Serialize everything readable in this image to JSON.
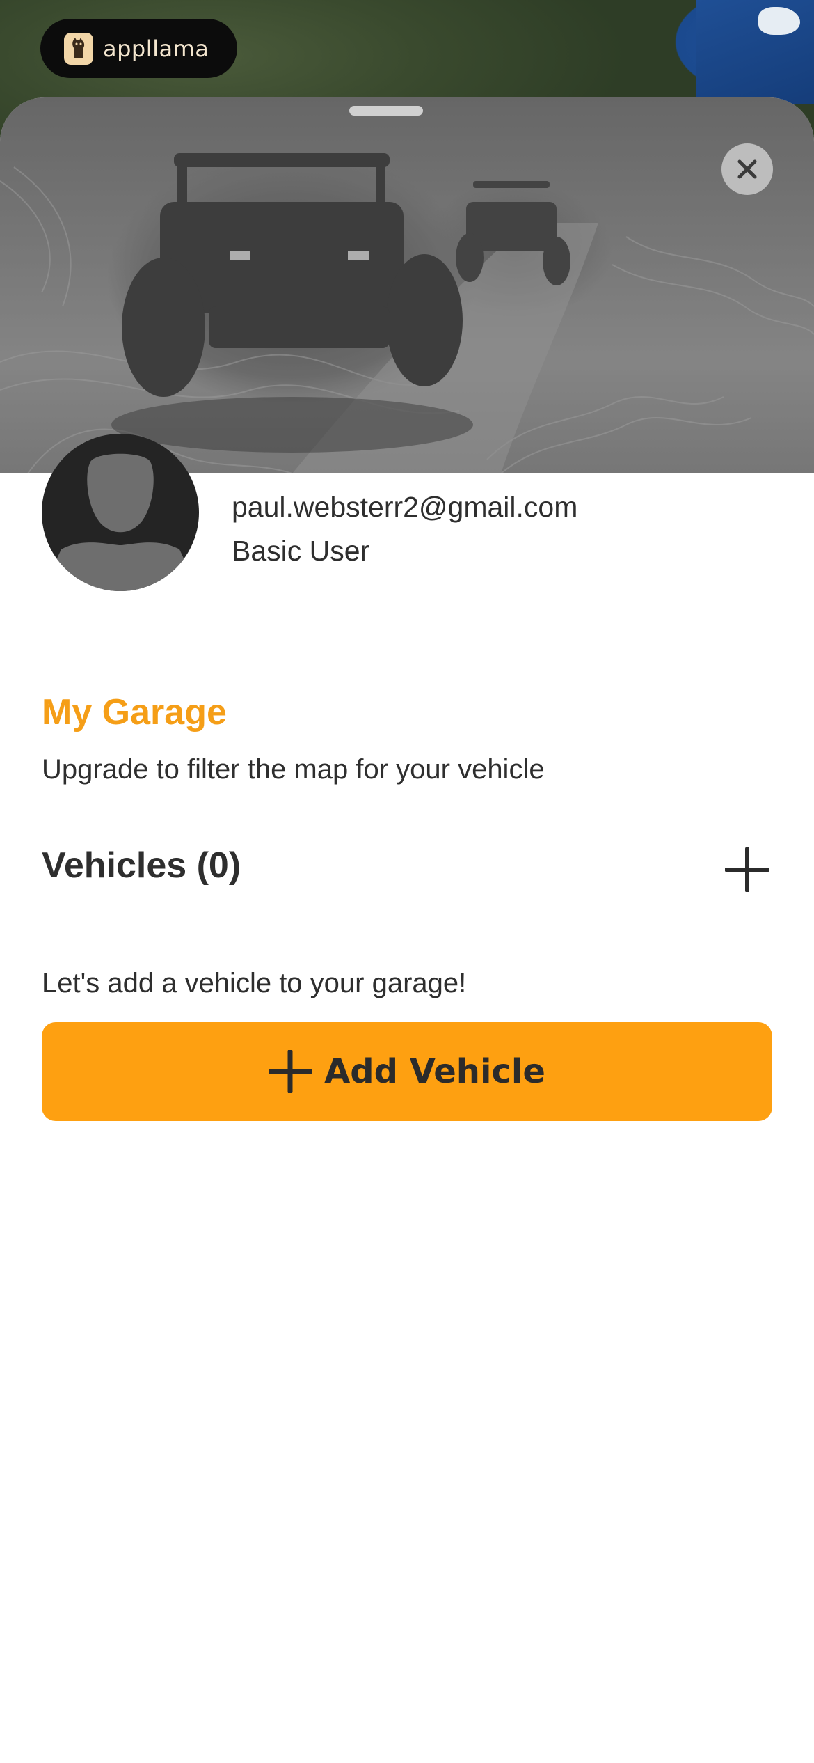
{
  "brand": {
    "name": "appllama",
    "logo_icon": "llama-logo-icon"
  },
  "profile": {
    "email": "paul.websterr2@gmail.com",
    "role": "Basic User"
  },
  "garage": {
    "title": "My Garage",
    "subtitle": "Upgrade to filter the map for your vehicle",
    "vehicles_label": "Vehicles (0)",
    "empty_message": "Let's add a vehicle to your garage!",
    "add_button_label": "Add Vehicle"
  },
  "colors": {
    "accent": "#f59e17",
    "button": "#fea011",
    "text": "#2e2e2e"
  }
}
